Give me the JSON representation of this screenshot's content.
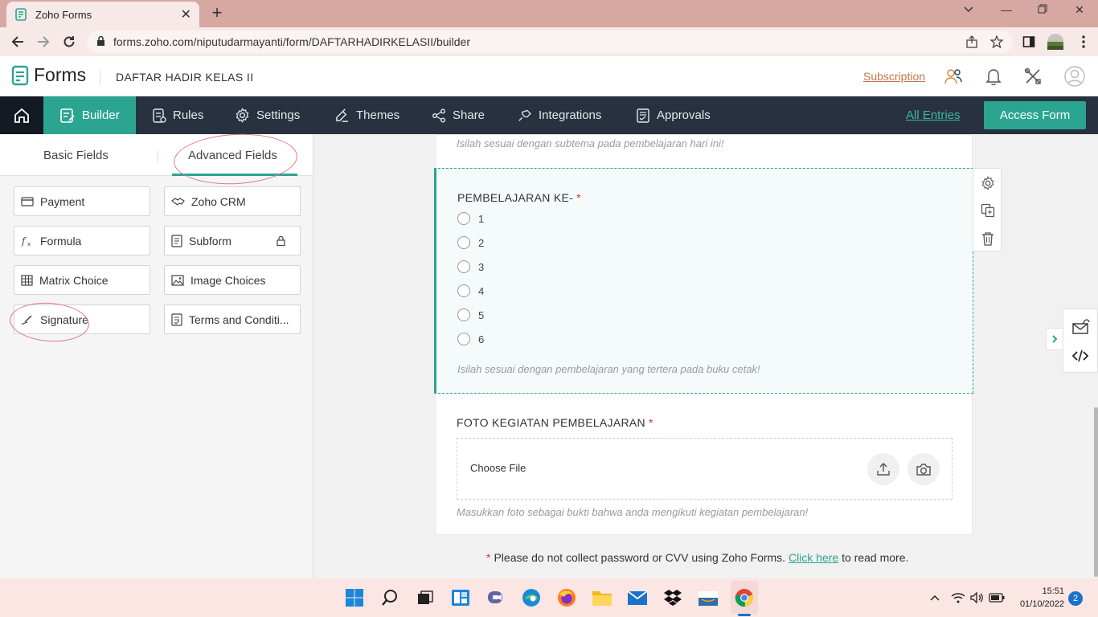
{
  "browser": {
    "tab_title": "Zoho Forms",
    "url": "forms.zoho.com/niputudarmayanti/form/DAFTARHADIRKELASII/builder"
  },
  "header": {
    "app_name": "Forms",
    "form_name": "DAFTAR HADIR KELAS II",
    "subscription": "Subscription"
  },
  "nav": {
    "items": [
      "Builder",
      "Rules",
      "Settings",
      "Themes",
      "Share",
      "Integrations",
      "Approvals"
    ],
    "active": "Builder",
    "all_entries": "All Entries",
    "access_form": "Access Form"
  },
  "panel": {
    "tabs": [
      "Basic Fields",
      "Advanced Fields"
    ],
    "active_tab": "Advanced Fields",
    "fields": [
      "Payment",
      "Zoho CRM",
      "Formula",
      "Subform",
      "Matrix Choice",
      "Image Choices",
      "Signature",
      "Terms and Conditi..."
    ]
  },
  "form": {
    "prev_hint": "Isilah sesuai dengan subtema pada pembelajaran hari ini!",
    "field1": {
      "label": "PEMBELAJARAN KE-",
      "required_mark": "*",
      "options": [
        "1",
        "2",
        "3",
        "4",
        "5",
        "6"
      ],
      "hint": "Isilah sesuai dengan pembelajaran yang tertera pada buku cetak!"
    },
    "field2": {
      "label": "FOTO KEGIATAN PEMBELAJARAN",
      "required_mark": "*",
      "choose_file": "Choose File",
      "hint": "Masukkan foto sebagai bukti bahwa anda mengikuti kegiatan pembelajaran!"
    },
    "note": {
      "star": "*",
      "text": "Please do not collect password or CVV using Zoho Forms.",
      "link": "Click here",
      "suffix": "to read more."
    }
  },
  "taskbar": {
    "time": "15:51",
    "date": "01/10/2022",
    "notifications": "2"
  },
  "colors": {
    "accent": "#2ba591",
    "nav_bg": "#27313f",
    "chrome_tab_bar": "#d7a7a1",
    "annotation": "#e07a7e"
  }
}
